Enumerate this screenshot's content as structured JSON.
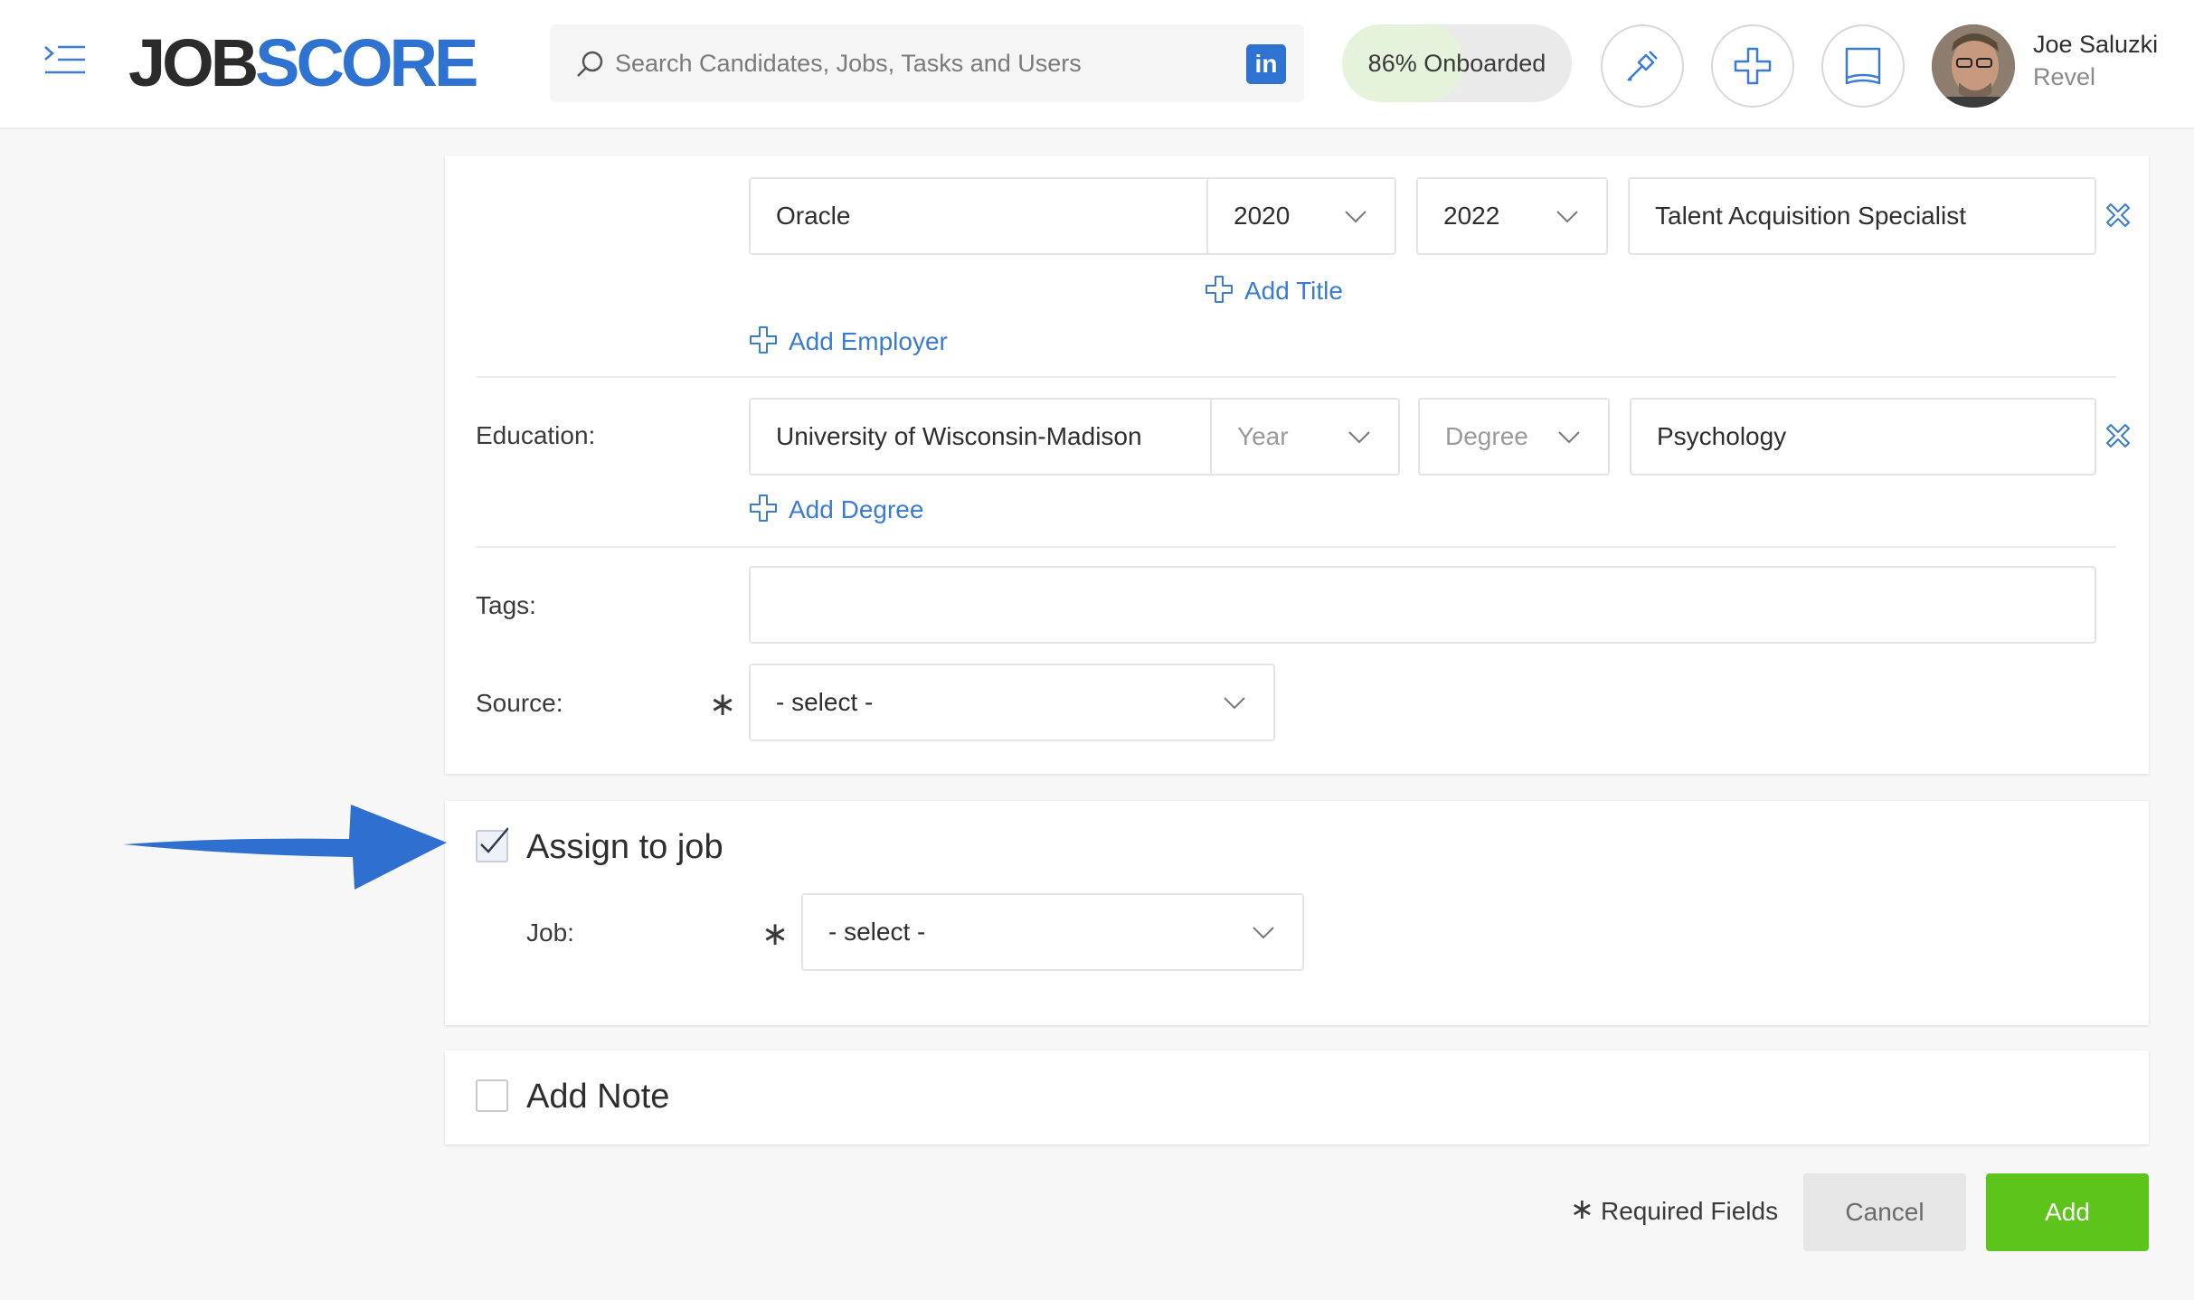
{
  "header": {
    "logo_job": "JOB",
    "logo_score": "SCORE",
    "search_placeholder": "Search Candidates, Jobs, Tasks and Users",
    "linkedin_label": "in",
    "onboarded_label": "86% Onboarded",
    "onboarded_progress": 0.86,
    "user_name": "Joe Saluzki",
    "user_org": "Revel"
  },
  "experience": {
    "employer": "Oracle",
    "start_year": "2020",
    "end_year": "2022",
    "title": "Talent Acquisition Specialist",
    "add_title_label": "Add Title",
    "add_employer_label": "Add Employer"
  },
  "education": {
    "label": "Education:",
    "school": "University of Wisconsin-Madison",
    "year_placeholder": "Year",
    "degree_placeholder": "Degree",
    "major": "Psychology",
    "add_degree_label": "Add Degree"
  },
  "tags": {
    "label": "Tags:",
    "value": ""
  },
  "source": {
    "label": "Source:",
    "required_mark": "∗",
    "value": "- select -"
  },
  "assign_job": {
    "checkbox_label": "Assign to job",
    "checked": true,
    "job_label": "Job:",
    "required_mark": "∗",
    "job_value": "- select -"
  },
  "add_note": {
    "checkbox_label": "Add Note",
    "checked": false
  },
  "footer": {
    "required_mark": "∗",
    "required_text": "Required Fields",
    "cancel_label": "Cancel",
    "add_label": "Add"
  },
  "colors": {
    "brand_blue": "#2e72d2",
    "link_blue": "#3a7bd5",
    "add_green": "#5cc41a",
    "arrow_blue": "#2f6fd0"
  }
}
